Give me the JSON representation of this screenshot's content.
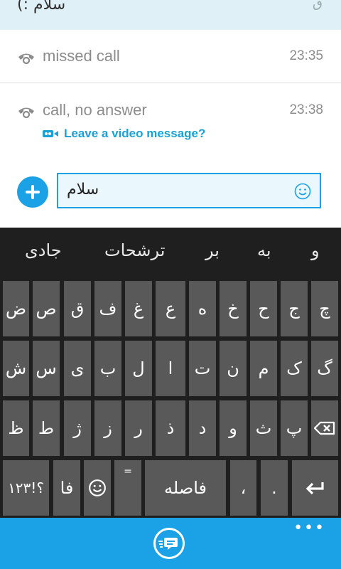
{
  "conversation": {
    "sent_message": "سلام :)",
    "calls": [
      {
        "text": "missed call",
        "time": "23:35"
      },
      {
        "text": "call, no answer",
        "time": "23:38"
      }
    ],
    "video_message_link": "Leave a video message?"
  },
  "composer": {
    "input_value": "سلام"
  },
  "keyboard": {
    "suggestions": [
      "و",
      "به",
      "بر",
      "ترشحات",
      "جادی"
    ],
    "row1": [
      "چ",
      "ج",
      "ح",
      "خ",
      "ه",
      "ع",
      "غ",
      "ف",
      "ق",
      "ص",
      "ض"
    ],
    "row2": [
      "گ",
      "ک",
      "م",
      "ن",
      "ت",
      "ا",
      "ل",
      "ب",
      "ی",
      "س",
      "ش"
    ],
    "row3": [
      "پ",
      "ث",
      "و",
      "د",
      "ذ",
      "ر",
      "ز",
      "ژ",
      "ط",
      "ظ"
    ],
    "row4": {
      "symbols": "؟!۱۲۳",
      "lang": "فا",
      "equals": "=",
      "space": "فاصله",
      "comma": "،",
      "period": "."
    }
  },
  "colors": {
    "accent": "#1aa1e6",
    "key": "#595959",
    "keyboard_bg": "#1f1f1f"
  }
}
